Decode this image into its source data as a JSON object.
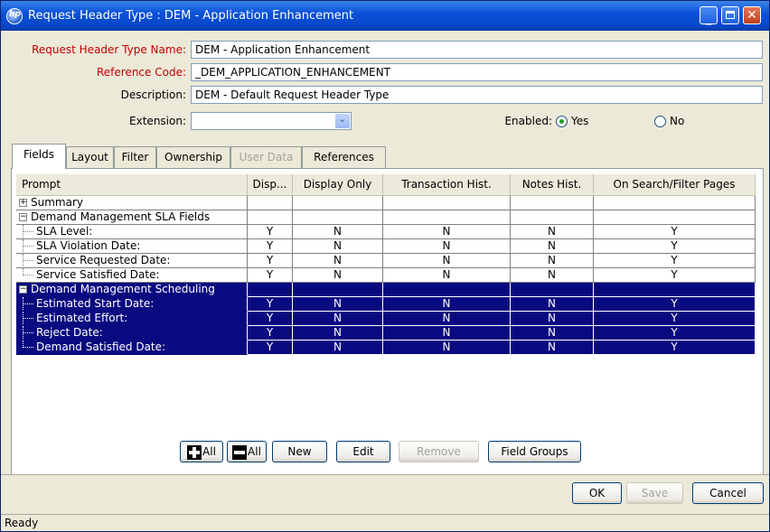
{
  "window": {
    "title": "Request Header Type : DEM - Application Enhancement"
  },
  "form": {
    "name_label": "Request Header Type Name:",
    "name_value": "DEM - Application Enhancement",
    "code_label": "Reference Code:",
    "code_value": "_DEM_APPLICATION_ENHANCEMENT",
    "desc_label": "Description:",
    "desc_value": "DEM - Default Request Header Type",
    "ext_label": "Extension:",
    "ext_value": "",
    "enabled_label": "Enabled:",
    "yes_label": "Yes",
    "no_label": "No",
    "enabled": "Yes"
  },
  "tabs": [
    {
      "label": "Fields",
      "active": true
    },
    {
      "label": "Layout"
    },
    {
      "label": "Filter"
    },
    {
      "label": "Ownership"
    },
    {
      "label": "User Data",
      "disabled": true
    },
    {
      "label": "References"
    }
  ],
  "table": {
    "headers": [
      "Prompt",
      "Disp...",
      "Display Only",
      "Transaction Hist.",
      "Notes Hist.",
      "On Search/Filter Pages"
    ],
    "rows": [
      {
        "prompt": "Summary",
        "kind": "group",
        "expander": "+",
        "cells": [
          "",
          "",
          "",
          "",
          ""
        ]
      },
      {
        "prompt": "Demand Management SLA Fields",
        "kind": "group",
        "expander": "−",
        "cells": [
          "",
          "",
          "",
          "",
          ""
        ]
      },
      {
        "prompt": "SLA Level:",
        "kind": "child",
        "cells": [
          "Y",
          "N",
          "N",
          "N",
          "Y"
        ]
      },
      {
        "prompt": "SLA Violation Date:",
        "kind": "child",
        "cells": [
          "Y",
          "N",
          "N",
          "N",
          "Y"
        ]
      },
      {
        "prompt": "Service Requested Date:",
        "kind": "child",
        "cells": [
          "Y",
          "N",
          "N",
          "N",
          "Y"
        ]
      },
      {
        "prompt": "Service Satisfied Date:",
        "kind": "child",
        "last": true,
        "cells": [
          "Y",
          "N",
          "N",
          "N",
          "Y"
        ]
      },
      {
        "prompt": "Demand Management Scheduling",
        "kind": "group",
        "expander": "−",
        "selected": true,
        "cells": [
          "",
          "",
          "",
          "",
          ""
        ]
      },
      {
        "prompt": "Estimated Start Date:",
        "kind": "child",
        "selected": true,
        "cells": [
          "Y",
          "N",
          "N",
          "N",
          "Y"
        ]
      },
      {
        "prompt": "Estimated Effort:",
        "kind": "child",
        "selected": true,
        "cells": [
          "Y",
          "N",
          "N",
          "N",
          "Y"
        ]
      },
      {
        "prompt": "Reject Date:",
        "kind": "child",
        "selected": true,
        "cells": [
          "Y",
          "N",
          "N",
          "N",
          "Y"
        ]
      },
      {
        "prompt": "Demand Satisfied Date:",
        "kind": "child",
        "selected": true,
        "last": true,
        "cells": [
          "Y",
          "N",
          "N",
          "N",
          "Y"
        ]
      }
    ]
  },
  "buttons": {
    "expand_all": "All",
    "collapse_all": "All",
    "new": "New",
    "edit": "Edit",
    "remove": "Remove",
    "field_groups": "Field Groups",
    "ok": "OK",
    "save": "Save",
    "cancel": "Cancel"
  },
  "status": "Ready",
  "colors": {
    "title_bar": "#0a52d9",
    "selection": "#0a0a80",
    "required_label": "#c00000"
  }
}
